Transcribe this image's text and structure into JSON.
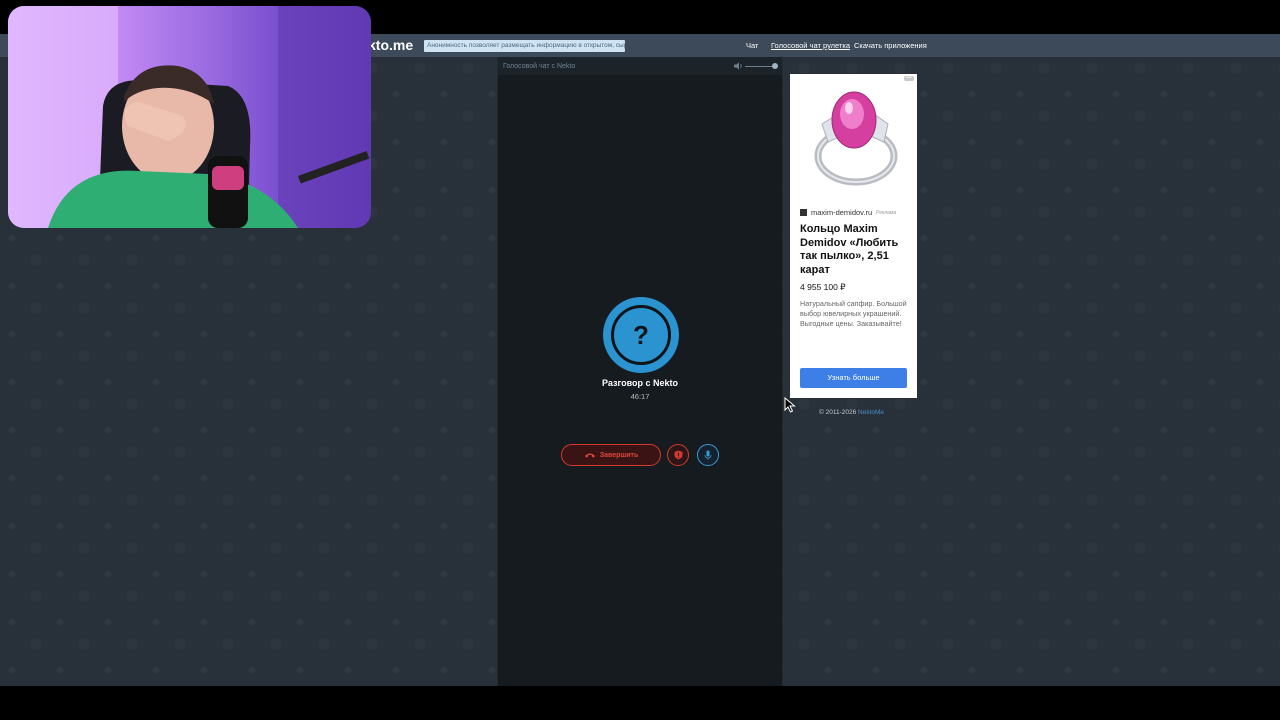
{
  "navbar": {
    "logo": "kto.me",
    "notice": "Анонимность позволяет размещать информацию в открытом, сыром виде",
    "links": [
      "Чат",
      "Голосовой чат рулетка",
      "Скачать приложения"
    ]
  },
  "chat": {
    "header_title": "Голосовой чат с Nekto",
    "avatar_symbol": "?",
    "conversation_label": "Разговор с Nekto",
    "timer": "46:17",
    "end_button": "Завершить"
  },
  "ad": {
    "domain": "maxim-demidov.ru",
    "tag": "Реклама",
    "title": "Кольцо Maxim Demidov «Любить так пылко», 2,51 карат",
    "price": "4 955 100 ₽",
    "description": "Натуральный сапфир. Большой выбор ювелирных украшений. Выгодные цены. Заказывайте!",
    "button": "Узнать больше"
  },
  "footer": {
    "copyright": "© 2011-2026",
    "brand": "NektoMe"
  },
  "colors": {
    "accent_blue": "#2a93d0",
    "end_red": "#d33a2c",
    "navbar": "#3c4a5a",
    "background": "#28313a"
  }
}
